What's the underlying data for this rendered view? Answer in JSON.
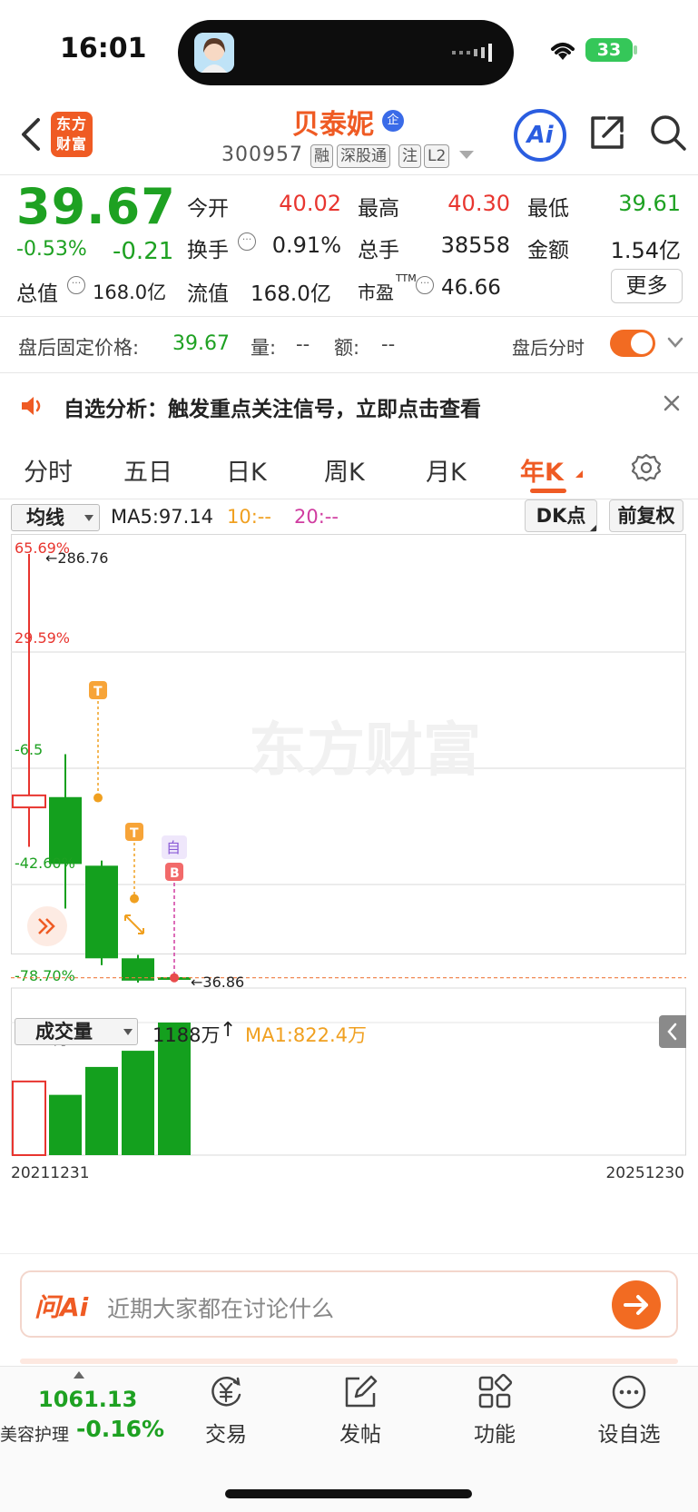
{
  "status_bar": {
    "time": "16:01",
    "battery": "33"
  },
  "header": {
    "logo_text_1": "东方",
    "logo_text_2": "财富",
    "stock_name": "贝泰妮",
    "stock_badge": "企",
    "stock_code": "300957",
    "tags": [
      "融",
      "深股通",
      "注",
      "L2"
    ],
    "ai_label": "Ai"
  },
  "quote": {
    "price": "39.67",
    "change_pct": "-0.53%",
    "change": "-0.21",
    "rows": [
      [
        {
          "label": "今开",
          "value": "40.02",
          "color": "red"
        },
        {
          "label": "最高",
          "value": "40.30",
          "color": "red"
        },
        {
          "label": "最低",
          "value": "39.61",
          "color": "green"
        }
      ],
      [
        {
          "label": "换手",
          "value": "0.91%",
          "color": "black"
        },
        {
          "label": "总手",
          "value": "38558",
          "color": "black"
        },
        {
          "label": "金额",
          "value": "1.54亿",
          "color": "black"
        }
      ]
    ],
    "total_value_label": "总值",
    "total_value": "168.0亿",
    "float_value_label": "流值",
    "float_value": "168.0亿",
    "pe_label": "市盈",
    "pe_sup": "TTM",
    "pe_value": "46.66",
    "more_label": "更多"
  },
  "after_hours": {
    "label": "盘后固定价格:",
    "price": "39.67",
    "vol_label": "量:",
    "vol": "--",
    "amt_label": "额:",
    "amt": "--",
    "time_label": "盘后分时"
  },
  "notice": {
    "text": "自选分析：触发重点关注信号，立即点击查看"
  },
  "tabs": [
    "分时",
    "五日",
    "日K",
    "周K",
    "月K",
    "年K"
  ],
  "active_tab": "年K",
  "chart_header": {
    "ma_select": "均线",
    "ma5": "MA5:97.14",
    "ma10": "10:--",
    "ma20": "20:--",
    "dk_btn": "DK点",
    "adjust_btn": "前复权"
  },
  "volume_header": {
    "select": "成交量",
    "value": "1188万",
    "arrow": "↑",
    "ma1": "MA1:822.4万"
  },
  "chart_data": {
    "type": "candlestick",
    "y_axis_labels": [
      "65.69%",
      "29.59%",
      "-6.5",
      "-42.60%",
      "-78.70%"
    ],
    "y_axis_colors": [
      "#e8352f",
      "#e8352f",
      "#1ea122",
      "#1ea122",
      "#1ea122"
    ],
    "watermark": "东方财富",
    "max_label": "←286.76",
    "min_label": "←36.86",
    "x_labels": [
      "20211231",
      "20251230"
    ],
    "price_range": [
      36.86,
      286.76
    ],
    "candles": [
      {
        "open": 139,
        "close": 146,
        "high": 286.76,
        "low": 116,
        "up": true
      },
      {
        "open": 145,
        "close": 106,
        "high": 170,
        "low": 80
      },
      {
        "open": 105,
        "close": 51,
        "high": 108,
        "low": 47
      },
      {
        "open": 51,
        "close": 38,
        "high": 53,
        "low": 36.86
      },
      {
        "open": 40.02,
        "close": 39.67,
        "high": 40.3,
        "low": 39.61
      }
    ],
    "volume_label": "1188万",
    "volumes_wan": [
      660,
      540,
      790,
      935,
      1188
    ],
    "markers": [
      {
        "candle": 1,
        "label": "T",
        "kind": "t"
      },
      {
        "candle": 2,
        "label": "T",
        "kind": "t"
      },
      {
        "candle": 4,
        "label": "B",
        "kind": "b",
        "extra": "自"
      }
    ],
    "colors": {
      "up": "#e8352f",
      "down": "#14a01e",
      "grid": "#e5e5e5"
    }
  },
  "ask_ai": {
    "brand": "问Ai",
    "placeholder": "近期大家都在讨论什么"
  },
  "bottom_bar": {
    "index_value": "1061.13",
    "index_name": "美容护理",
    "index_pct": "-0.16%",
    "items": [
      {
        "label": "交易",
        "icon": "trade-icon"
      },
      {
        "label": "发帖",
        "icon": "post-icon"
      },
      {
        "label": "功能",
        "icon": "apps-icon"
      },
      {
        "label": "设自选",
        "icon": "more-icon"
      }
    ]
  }
}
